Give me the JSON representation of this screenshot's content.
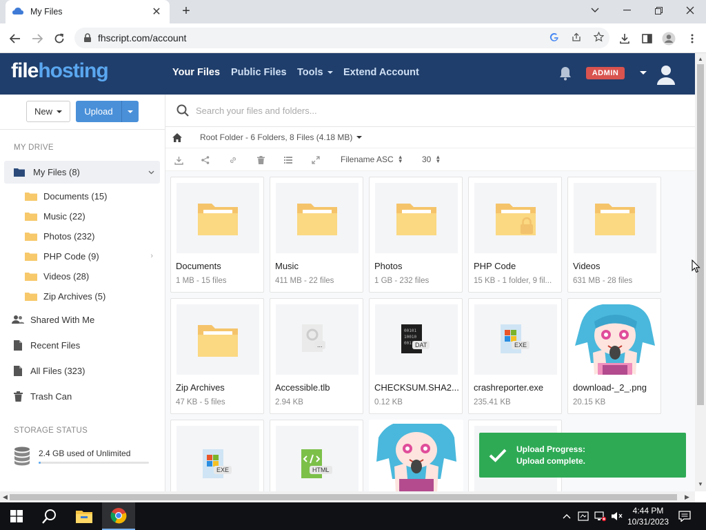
{
  "browser": {
    "tab_title": "My Files",
    "tab_close": "✕",
    "new_tab": "+",
    "url": "fhscript.com/account"
  },
  "header": {
    "logo_part1": "file",
    "logo_part2": "hosting",
    "nav": {
      "your_files": "Your Files",
      "public_files": "Public Files",
      "tools": "Tools",
      "extend_account": "Extend Account"
    },
    "admin_badge": "ADMIN"
  },
  "sidebar": {
    "new_button": "New",
    "upload_button": "Upload",
    "my_drive_heading": "MY DRIVE",
    "my_files": "My Files (8)",
    "folders": [
      "Documents (15)",
      "Music (22)",
      "Photos (232)",
      "PHP Code (9)",
      "Videos (28)",
      "Zip Archives (5)"
    ],
    "shared": "Shared With Me",
    "recent": "Recent Files",
    "all_files": "All Files (323)",
    "trash": "Trash Can",
    "storage_heading": "STORAGE STATUS",
    "storage_text": "2.4 GB used of Unlimited"
  },
  "main": {
    "search_placeholder": "Search your files and folders...",
    "breadcrumb": "Root Folder - 6 Folders, 8 Files (4.18 MB)",
    "sort_label": "Filename ASC",
    "per_page": "30",
    "items": [
      {
        "name": "Documents",
        "meta": "1 MB - 15 files"
      },
      {
        "name": "Music",
        "meta": "411 MB - 22 files"
      },
      {
        "name": "Photos",
        "meta": "1 GB - 232 files"
      },
      {
        "name": "PHP Code",
        "meta": "15 KB - 1 folder, 9 fil..."
      },
      {
        "name": "Videos",
        "meta": "631 MB - 28 files"
      },
      {
        "name": "Zip Archives",
        "meta": "47 KB - 5 files"
      },
      {
        "name": "Accessible.tlb",
        "meta": "2.94 KB",
        "badge": "..."
      },
      {
        "name": "CHECKSUM.SHA2...",
        "meta": "0.12 KB",
        "badge": "DAT"
      },
      {
        "name": "crashreporter.exe",
        "meta": "235.41 KB",
        "badge": "EXE"
      },
      {
        "name": "download-_2_.png",
        "meta": "20.15 KB"
      },
      {
        "badge": "EXE"
      },
      {
        "badge": "HTML"
      }
    ]
  },
  "toast": {
    "title": "Upload Progress:",
    "message": "Upload complete."
  },
  "taskbar": {
    "time": "4:44 PM",
    "date": "10/31/2023"
  },
  "colors": {
    "header_bg": "#203e6b",
    "accent_blue": "#4a90d9",
    "admin_red": "#d9534f",
    "toast_green": "#2eaa55",
    "folder_yellow": "#f7c96b"
  }
}
